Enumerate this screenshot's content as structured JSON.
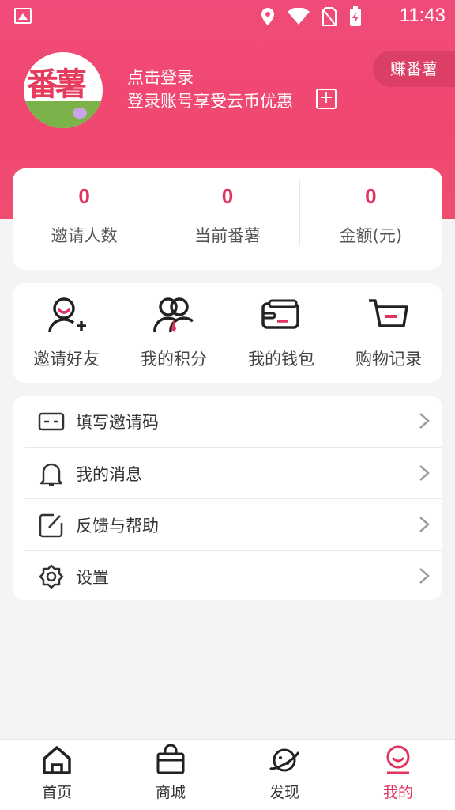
{
  "status_bar": {
    "time": "11:43",
    "icons": [
      "image-icon",
      "location-icon",
      "wifi-icon",
      "no-sim-icon",
      "battery-charging-icon"
    ]
  },
  "profile": {
    "avatar_text": "番薯",
    "title": "点击登录",
    "subtitle": "登录账号享受云币优惠",
    "earn_button": "赚番薯"
  },
  "stats": [
    {
      "value": "0",
      "label": "邀请人数"
    },
    {
      "value": "0",
      "label": "当前番薯"
    },
    {
      "value": "0",
      "label": "金额(元)"
    }
  ],
  "quick_actions": [
    {
      "label": "邀请好友",
      "icon": "invite-user-icon"
    },
    {
      "label": "我的积分",
      "icon": "points-users-icon"
    },
    {
      "label": "我的钱包",
      "icon": "wallet-icon"
    },
    {
      "label": "购物记录",
      "icon": "cart-icon"
    }
  ],
  "menu": [
    {
      "label": "填写邀请码",
      "icon": "code-card-icon"
    },
    {
      "label": "我的消息",
      "icon": "bell-icon"
    },
    {
      "label": "反馈与帮助",
      "icon": "feedback-icon"
    },
    {
      "label": "设置",
      "icon": "gear-icon"
    }
  ],
  "tabs": [
    {
      "label": "首页",
      "icon": "home-icon",
      "active": false
    },
    {
      "label": "商城",
      "icon": "shop-bag-icon",
      "active": false
    },
    {
      "label": "发现",
      "icon": "planet-icon",
      "active": false
    },
    {
      "label": "我的",
      "icon": "profile-icon",
      "active": true
    }
  ],
  "colors": {
    "accent": "#e0345e",
    "header": "#f04b78",
    "background": "#f4f4f4"
  }
}
